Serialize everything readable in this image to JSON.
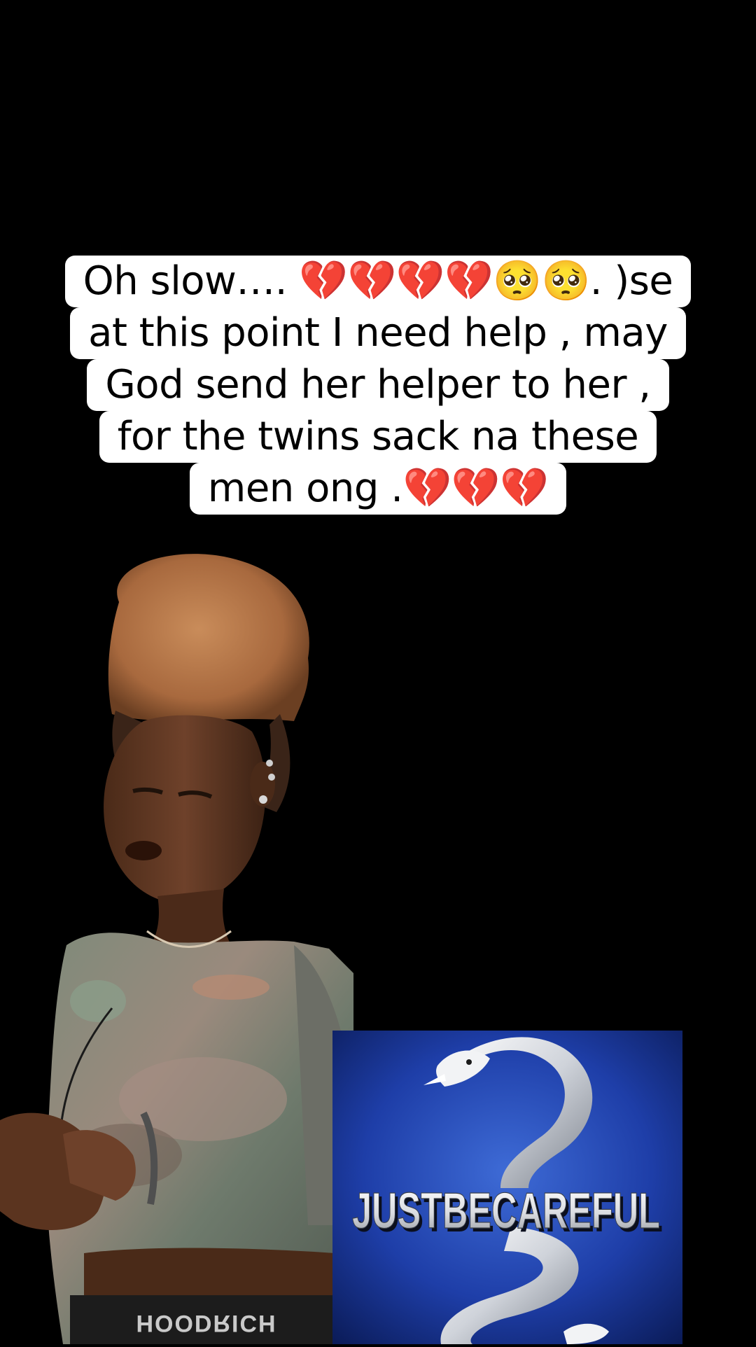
{
  "caption": {
    "lines": [
      "Oh slow…. 💔💔💔💔🥺🥺. )se",
      "at this point I need help , may",
      "God send her helper to her ,",
      "for the twins sack na these",
      "men ong .💔💔💔"
    ]
  },
  "overlay_logo": {
    "text": "JUSTBECAREFUL",
    "icon": "serpent-icon"
  },
  "shirt_print": {
    "text": "HOODRICH"
  },
  "colors": {
    "background": "#000000",
    "caption_bg": "#ffffff",
    "caption_text": "#000000",
    "logo_bg": "#1a3a9a"
  }
}
